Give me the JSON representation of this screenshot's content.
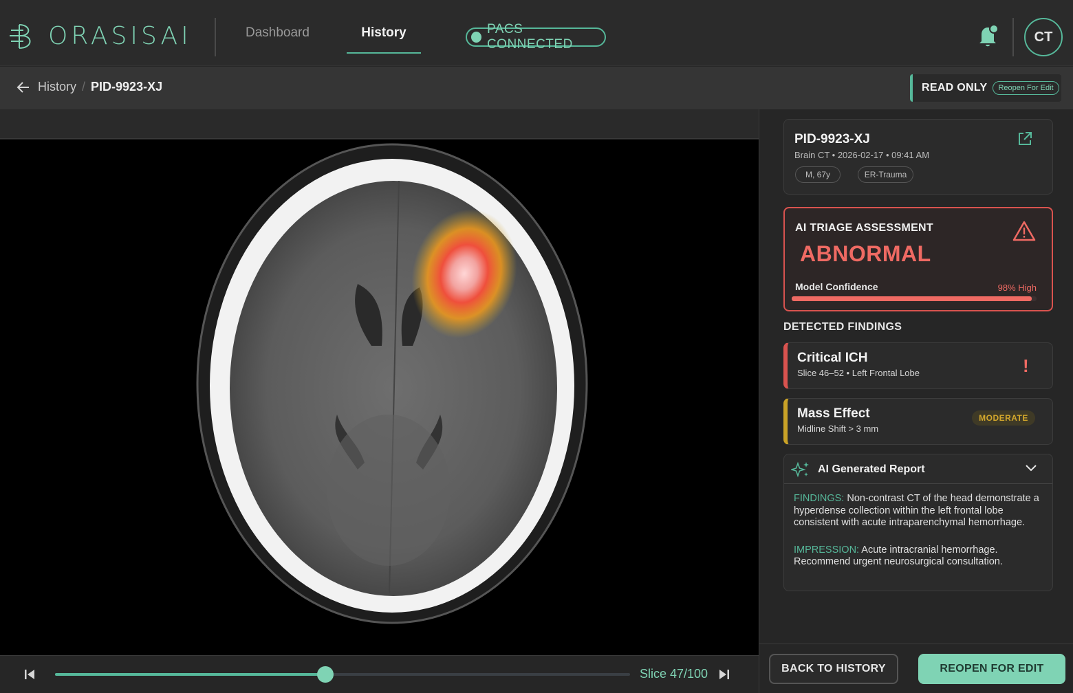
{
  "app": {
    "brand": "ORASISAI"
  },
  "nav": {
    "items": [
      {
        "label": "Dashboard"
      },
      {
        "label": "History",
        "active": true
      }
    ]
  },
  "status": {
    "pacs": "PACS CONNECTED"
  },
  "user": {
    "initials": "CT"
  },
  "breadcrumb": {
    "parent": "History",
    "separator": "/",
    "current": "PID-9923-XJ"
  },
  "mode": {
    "label": "READ ONLY",
    "action": "Reopen For Edit"
  },
  "viewer": {
    "slice_label": "Slice 47/100",
    "slice_current": 47,
    "slice_total": 100
  },
  "patient": {
    "id": "PID-9923-XJ",
    "meta": "Brain CT • 2026-02-17 • 09:41 AM",
    "tags": [
      "M, 67y",
      "ER-Trauma"
    ]
  },
  "triage": {
    "title": "AI TRIAGE ASSESSMENT",
    "status": "ABNORMAL",
    "confidence_label": "Model Confidence",
    "confidence_text": "98% High",
    "confidence": 0.98
  },
  "findings": {
    "title": "DETECTED FINDINGS",
    "items": [
      {
        "title": "Critical ICH",
        "subtitle": "Slice 46–52 • Left Frontal Lobe",
        "badge": "!"
      },
      {
        "title": "Mass Effect",
        "subtitle": "Midline Shift > 3 mm",
        "badge": "MODERATE"
      }
    ]
  },
  "report": {
    "title": "AI Generated Report",
    "findings_label": "FINDINGS:",
    "findings_text": " Non-contrast CT of the head demonstrate a hyperdense collection within the left frontal lobe consistent with acute intraparenchymal hemorrhage.",
    "impression_label": "IMPRESSION:",
    "impression_text": " Acute intracranial hemorrhage. Recommend urgent neurosurgical consultation."
  },
  "actions": {
    "back": "BACK TO HISTORY",
    "reopen": "REOPEN FOR EDIT"
  },
  "colors": {
    "accent": "#7fd3b4",
    "critical": "#ef6a63",
    "moderate": "#d4a82c"
  },
  "icons": [
    "logo-mark-icon",
    "bell-icon",
    "arrow-left-icon",
    "external-link-icon",
    "warning-triangle-icon",
    "sparkle-icon",
    "chevron-down-icon",
    "skip-start-icon",
    "skip-end-icon"
  ]
}
